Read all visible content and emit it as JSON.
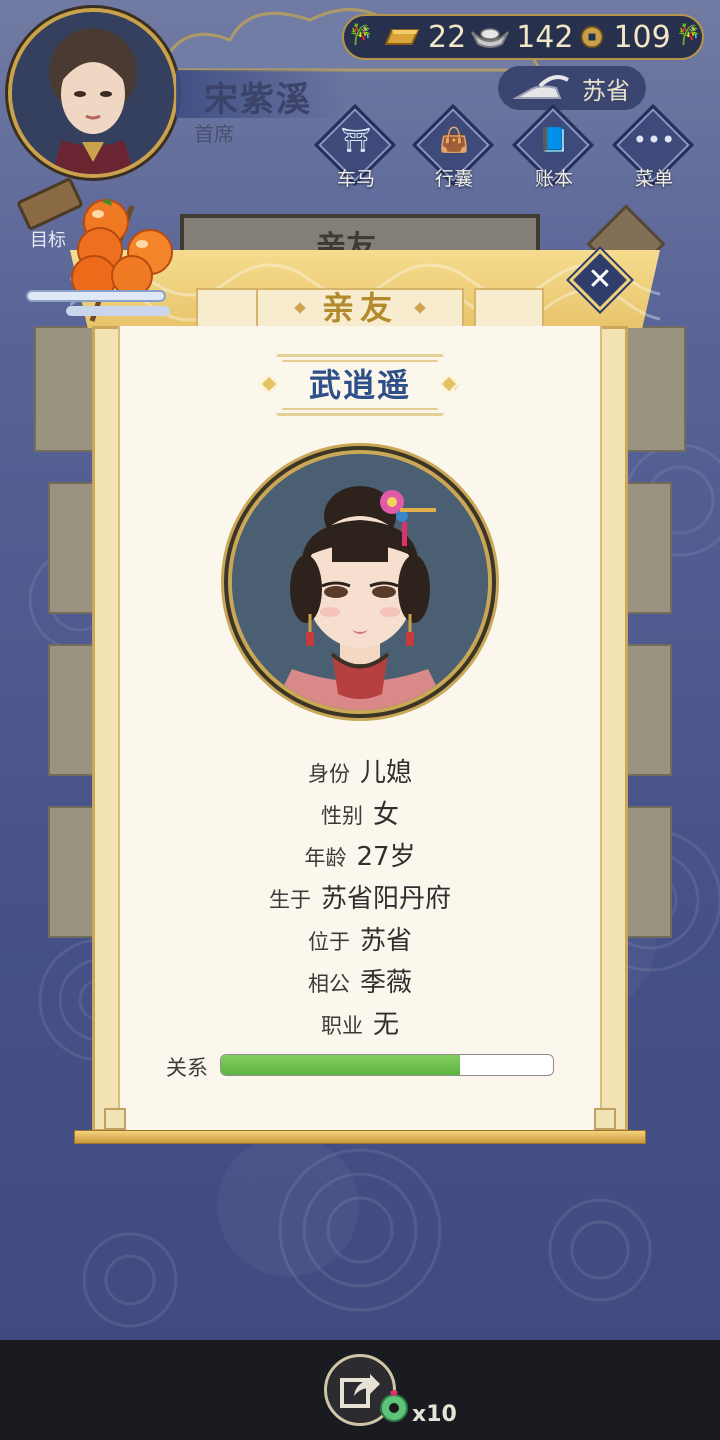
{
  "player": {
    "name": "宋紫溪",
    "title": "首席"
  },
  "currency": {
    "gold": "22",
    "silver": "142",
    "coins": "109"
  },
  "location": "苏省",
  "hud_buttons": [
    {
      "label": "车马",
      "icon": "carriage-icon"
    },
    {
      "label": "行囊",
      "icon": "bag-icon"
    },
    {
      "label": "账本",
      "icon": "ledger-icon"
    },
    {
      "label": "菜单",
      "icon": "menu-icon"
    }
  ],
  "goal_label": "目标",
  "background_panel_title": "亲友",
  "modal": {
    "title": "亲友",
    "name": "武逍遥",
    "details": [
      {
        "key": "身份",
        "value": "儿媳"
      },
      {
        "key": "性别",
        "value": "女"
      },
      {
        "key": "年龄",
        "value": "27岁"
      },
      {
        "key": "生于",
        "value": "苏省阳丹府"
      },
      {
        "key": "位于",
        "value": "苏省"
      },
      {
        "key": "相公",
        "value": "季薇"
      },
      {
        "key": "职业",
        "value": "无"
      }
    ],
    "relation_label": "关系",
    "relation_fraction": 0.72
  },
  "share": {
    "count": "x10",
    "icon": "share-icon"
  },
  "colors": {
    "accent_gold": "#e7c46a",
    "name_blue": "#2e4f8a",
    "relation_green": "#5db440",
    "background": "#5d6aa6"
  }
}
